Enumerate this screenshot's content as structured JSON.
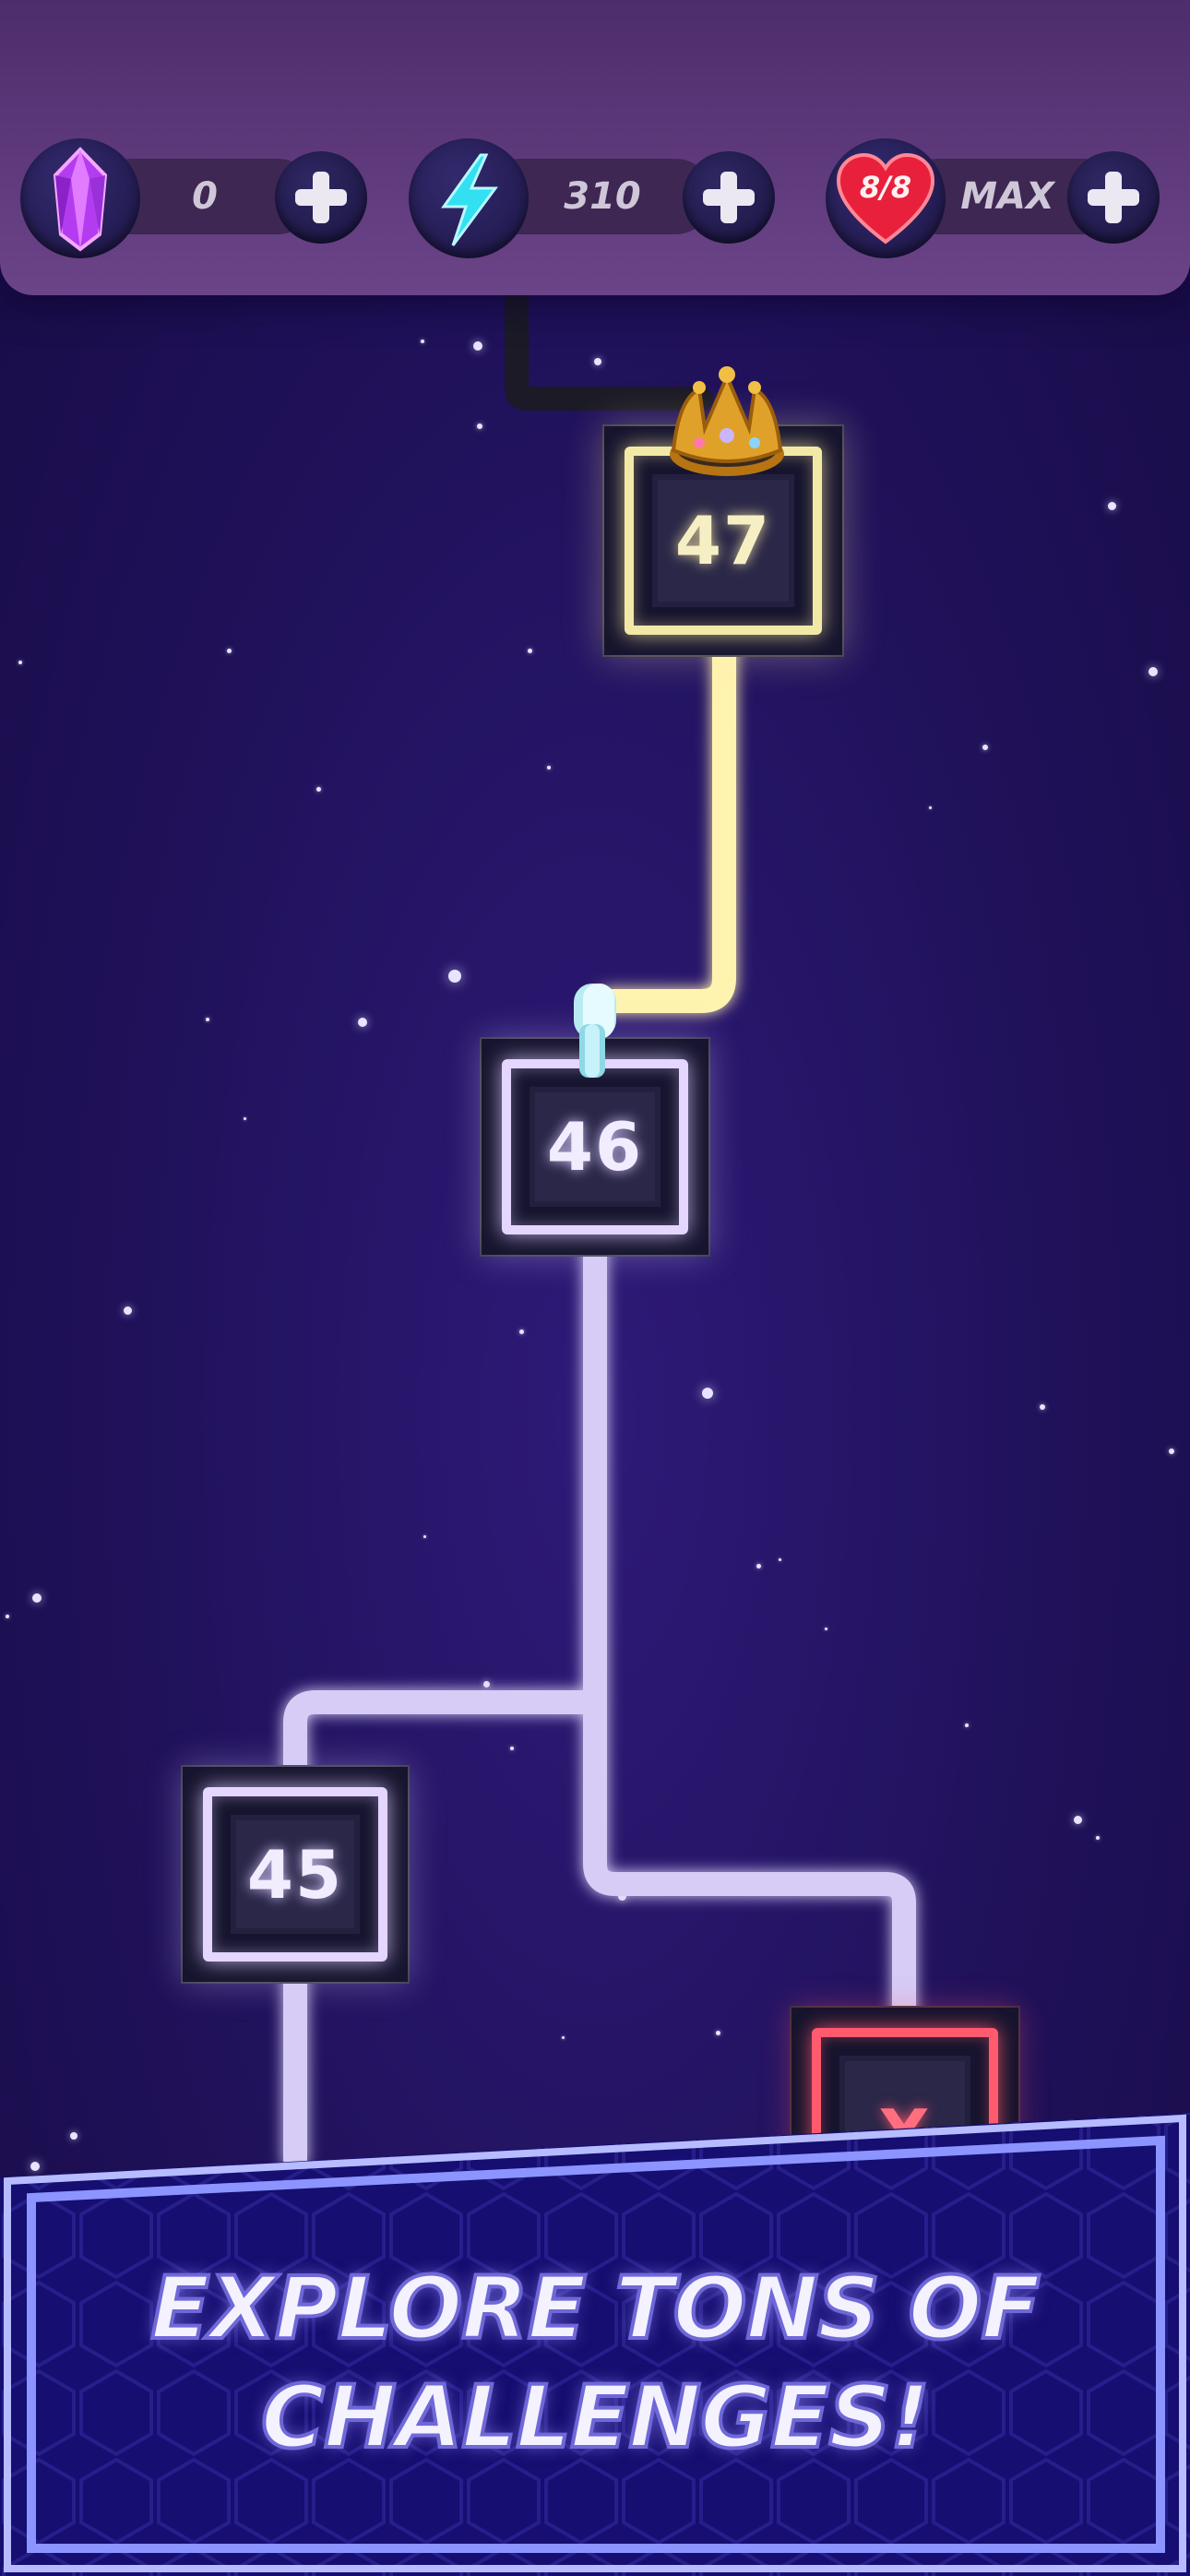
{
  "hud": {
    "gems": {
      "value": "0",
      "icon": "purple-crystal-icon"
    },
    "energy": {
      "value": "310",
      "icon": "lightning-bolt-icon"
    },
    "lives": {
      "badge": "8/8",
      "value": "MAX",
      "icon": "heart-icon"
    }
  },
  "levels": [
    {
      "id": "47",
      "state": "completed",
      "color": "#f3e9a6",
      "decor": "crown-icon"
    },
    {
      "id": "46",
      "state": "current",
      "color": "#e4d6ff",
      "decor": "player-token-icon"
    },
    {
      "id": "45",
      "state": "completed",
      "color": "#e4d6ff"
    },
    {
      "id": "X",
      "state": "locked",
      "color": "#ff5a6e"
    }
  ],
  "banner": {
    "line1": "EXPLORE TONS OF",
    "line2": "CHALLENGES!"
  },
  "colors": {
    "background": "#20115a",
    "topbar": "#5e3b7c",
    "path_active": "#fff3b0",
    "path_default": "#d3c8f4",
    "locked": "#ff5a6e",
    "banner_border": "#9aa0ff"
  }
}
